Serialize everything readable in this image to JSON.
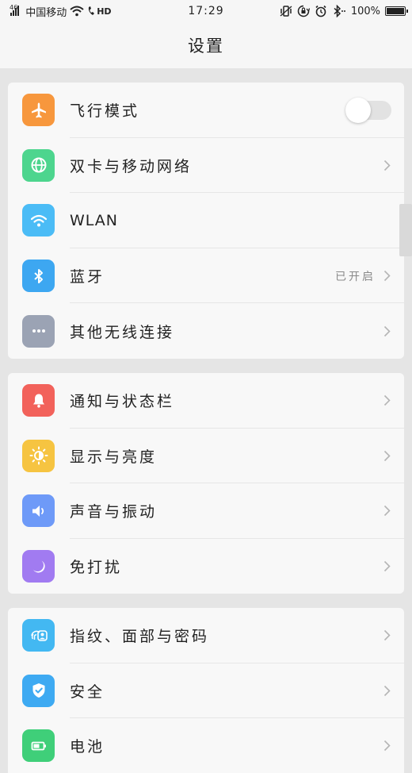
{
  "status_bar": {
    "signal_text": "46",
    "carrier": "中国移动",
    "network_badge": "HD",
    "time": "17:29",
    "battery_text": "100%",
    "battery_level": 1.0,
    "icons": [
      "signal-icon",
      "wifi-icon",
      "hd-call-icon",
      "vibrate-icon",
      "rotation-lock-icon",
      "alarm-icon",
      "bluetooth-icon",
      "battery-icon"
    ]
  },
  "header": {
    "title": "设置"
  },
  "groups": [
    {
      "items": [
        {
          "label": "飞行模式",
          "icon": "airplane-icon",
          "color": "#f7973d",
          "control": "toggle",
          "toggle_on": false
        },
        {
          "label": "双卡与移动网络",
          "icon": "globe-icon",
          "color": "#4dd58e",
          "control": "chevron"
        },
        {
          "label": "WLAN",
          "icon": "wifi-icon",
          "color": "#4bbcf6",
          "control": "none"
        },
        {
          "label": "蓝牙",
          "icon": "bluetooth-icon",
          "color": "#3da7f1",
          "control": "chevron",
          "value": "已开启"
        },
        {
          "label": "其他无线连接",
          "icon": "more-dots-icon",
          "color": "#9ba3b4",
          "control": "chevron"
        }
      ]
    },
    {
      "items": [
        {
          "label": "通知与状态栏",
          "icon": "bell-icon",
          "color": "#f2625b",
          "control": "chevron"
        },
        {
          "label": "显示与亮度",
          "icon": "brightness-icon",
          "color": "#f6c441",
          "control": "chevron"
        },
        {
          "label": "声音与振动",
          "icon": "speaker-icon",
          "color": "#6e9af8",
          "control": "chevron"
        },
        {
          "label": "免打扰",
          "icon": "moon-icon",
          "color": "#a17bf1",
          "control": "chevron"
        }
      ]
    },
    {
      "items": [
        {
          "label": "指纹、面部与密码",
          "icon": "fingerprint-face-icon",
          "color": "#43b8f2",
          "control": "chevron"
        },
        {
          "label": "安全",
          "icon": "shield-check-icon",
          "color": "#3eaaf2",
          "control": "chevron"
        },
        {
          "label": "电池",
          "icon": "battery-icon",
          "color": "#3fcf79",
          "control": "chevron"
        }
      ]
    }
  ]
}
